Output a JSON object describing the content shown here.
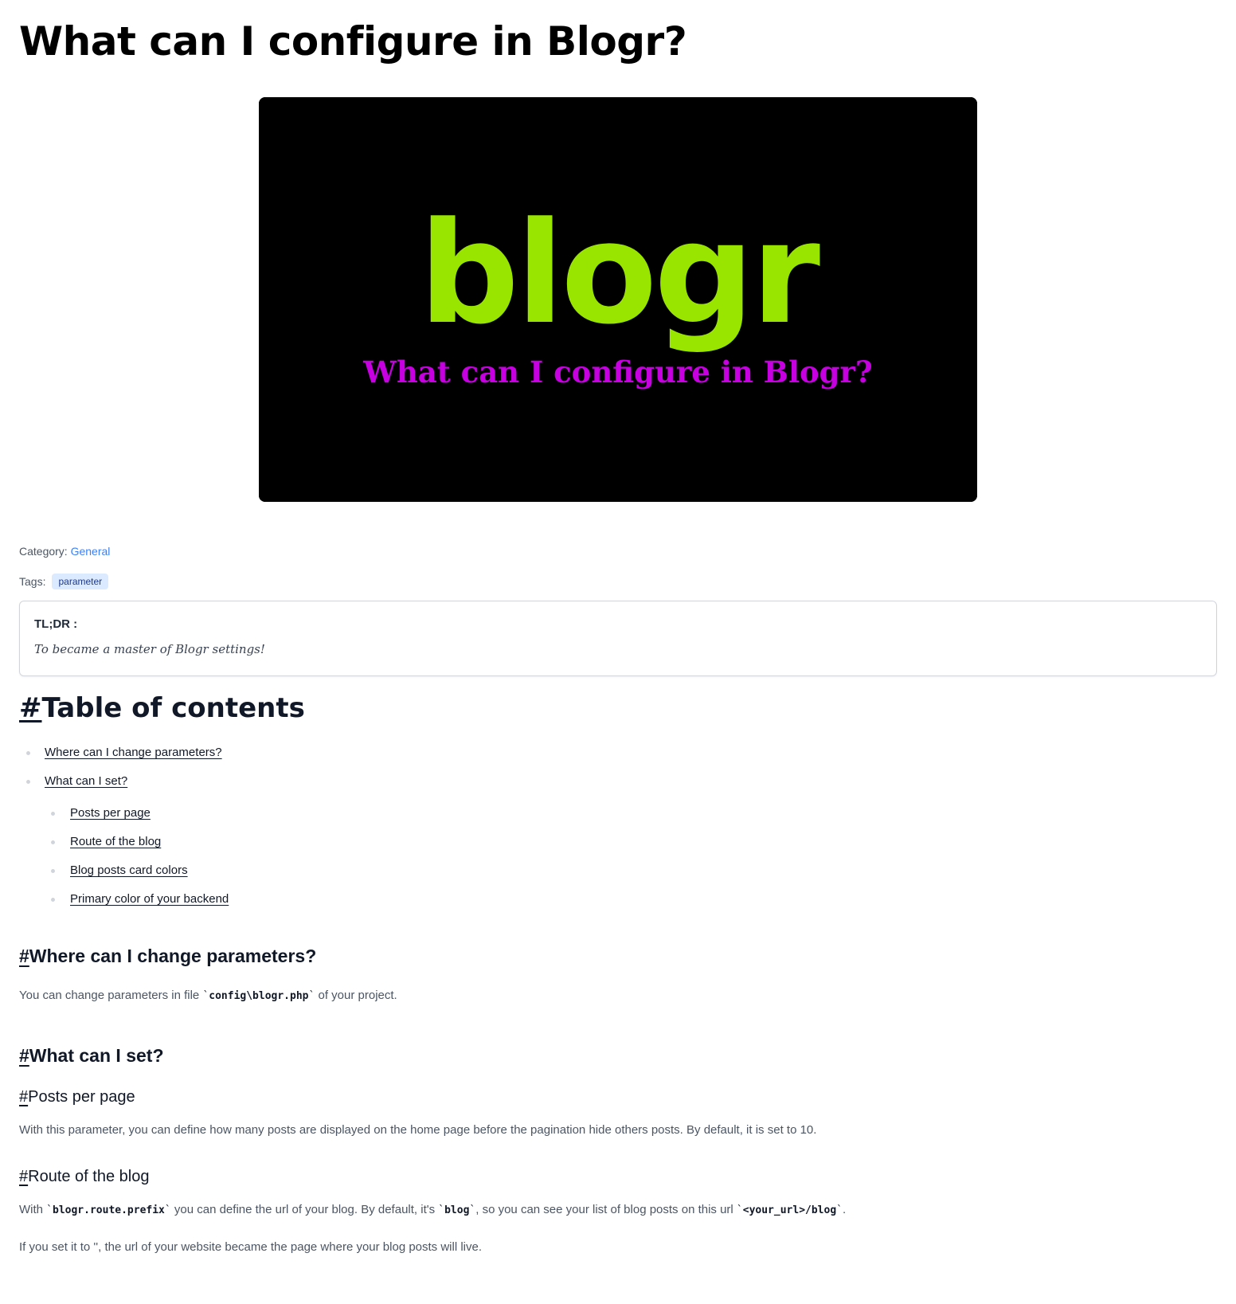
{
  "article": {
    "title": "What can I configure in Blogr?"
  },
  "hero": {
    "logo_text": "blogr",
    "subtitle": "What can I configure in Blogr?",
    "logo_color": "#99e500",
    "subtitle_color": "#c600e0",
    "background": "#000000"
  },
  "meta": {
    "category_label": "Category:",
    "category_value": "General",
    "tags_label": "Tags:",
    "tags": [
      "parameter"
    ]
  },
  "tldr": {
    "label": "TL;DR :",
    "text": "To became a master of Blogr settings!"
  },
  "toc": {
    "hash": "#",
    "title": "Table of contents",
    "items": [
      {
        "label": "Where can I change parameters?"
      },
      {
        "label": "What can I set?"
      }
    ],
    "subitems": [
      {
        "label": "Posts per page"
      },
      {
        "label": "Route of the blog"
      },
      {
        "label": "Blog posts card colors"
      },
      {
        "label": "Primary color of your backend"
      }
    ]
  },
  "sections": {
    "hash": "#",
    "where": {
      "title": "Where can I change parameters?",
      "text_before": "You can change parameters in file ",
      "code": "config\\blogr.php",
      "text_after": " of your project."
    },
    "what": {
      "title": "What can I set?"
    },
    "posts_per_page": {
      "title": "Posts per page",
      "text": "With this parameter, you can define how many posts are displayed on the home page before the pagination hide others posts. By default, it is set to 10."
    },
    "route": {
      "title": "Route of the blog",
      "p1_a": "With ",
      "code1": "blogr.route.prefix",
      "p1_b": " you can define the url of your blog. By default, it's ",
      "code2": "blog",
      "p1_c": ", so you can see your list of blog posts on this url ",
      "code3": "<your_url>/blog",
      "p1_d": ".",
      "p2": "If you set it to '', the url of your website became the page where your blog posts will live."
    }
  },
  "backtick": "`"
}
